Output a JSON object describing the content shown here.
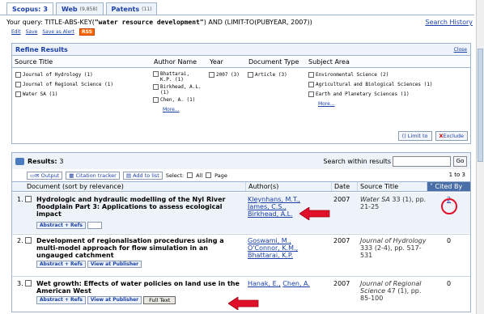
{
  "tabs": [
    {
      "label": "Scopus:",
      "count": "3"
    },
    {
      "label": "Web",
      "count": "(9,858)"
    },
    {
      "label": "Patents",
      "count": "(11)"
    }
  ],
  "query": {
    "prefix": "Your query: TITLE-ABS-KEY(",
    "term": "\"water resource development\"",
    "suffix": ") AND (LIMIT-TO(PUBYEAR, 2007))",
    "links": [
      "Edit",
      "Save",
      "Save as Alert"
    ],
    "rss": "RSS",
    "history": "Search History"
  },
  "refine": {
    "title": "Refine Results",
    "close": "Close",
    "columns": [
      "Source Title",
      "Author Name",
      "Year",
      "Document Type",
      "Subject Area"
    ],
    "sources": [
      "Journal of Hydrology (1)",
      "Journal of Regional Science (1)",
      "Water SA (1)"
    ],
    "authors": [
      "Bhattarai, K.P. (1)",
      "Birkhead, A.L. (1)",
      "Chen, A. (1)"
    ],
    "authors_more": "More...",
    "years": [
      "2007 (3)"
    ],
    "doctypes": [
      "Article (3)"
    ],
    "subjects": [
      "Environmental Science (2)",
      "Agricultural and Biological Sciences (1)",
      "Earth and Planetary Sciences (1)"
    ],
    "subjects_more": "More...",
    "limit_btn": "Limit to",
    "exclude_btn": "Exclude"
  },
  "results": {
    "label": "Results:",
    "count": "3",
    "search_within": "Search within results",
    "go": "Go",
    "toolbar": {
      "output": "Output",
      "citation": "Citation tracker",
      "add": "Add to list",
      "select": "Select:",
      "all": "All",
      "page": "Page"
    },
    "range": "1 to 3",
    "headers": [
      "Document (sort by relevance)",
      "Author(s)",
      "Date",
      "Source Title",
      "Cited By"
    ],
    "rows": [
      {
        "num": "1.",
        "title": "Hydrologic and hydraulic modelling of the Nyl River floodplain Part 3: Applications to assess ecological impact",
        "authors": [
          "Kleynhans, M.T.,",
          "James, C.S.,",
          "Birkhead, A.L."
        ],
        "date": "2007",
        "source_journal": "Water SA",
        "source_rest": " 33 (1), pp. 21-25",
        "cited": "2",
        "links": [
          "Abstract + Refs"
        ]
      },
      {
        "num": "2.",
        "title": "Development of regionalisation procedures using a multi-model approach for flow simulation in an ungauged catchment",
        "authors": [
          "Goswami, M.,",
          "O'Connor, K.M.,",
          "Bhattarai, K.P."
        ],
        "date": "2007",
        "source_journal": "Journal of Hydrology",
        "source_rest": " 333 (2-4), pp. 517-531",
        "cited": "0",
        "links": [
          "Abstract + Refs",
          "View at Publisher"
        ]
      },
      {
        "num": "3.",
        "title": "Wet growth: Effects of water policies on land use in the American West",
        "authors": [
          "Hanak, E.,",
          "Chen, A."
        ],
        "date": "2007",
        "source_journal": "Journal of Regional Science",
        "source_rest": " 47 (1), pp. 85-100",
        "cited": "0",
        "links": [
          "Abstract + Refs",
          "View at Publisher",
          "Full Text"
        ]
      }
    ]
  },
  "colors": {
    "accent": "#1a3fa8",
    "panel": "#eef3f9",
    "border": "#9db3cf",
    "annotation": "#e0102a"
  }
}
